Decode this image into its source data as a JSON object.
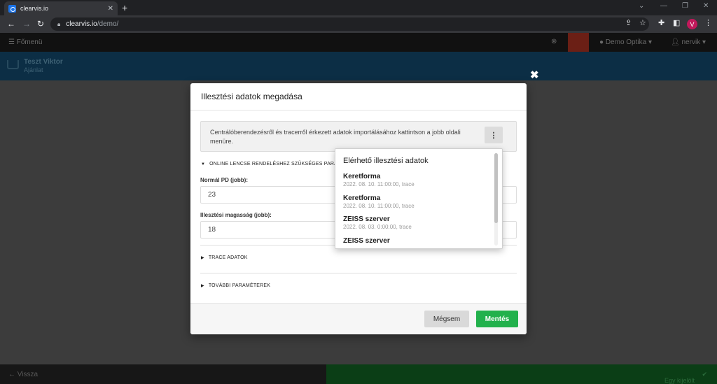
{
  "browser": {
    "tab_title": "clearvis.io",
    "tab_close": "✕",
    "new_tab": "+",
    "url_host": "clearvis.io",
    "url_path": "/demo/",
    "profile_initial": "V"
  },
  "app": {
    "menu_label": "☰ Főmenü",
    "org_label": "Demo Optika",
    "user_label": "nervik",
    "customer_name": "Teszt Viktor",
    "customer_sub": "Ajánlat",
    "back_label": "Vissza",
    "footer_status": "Egy kijelölt ajánlat elfogadásra"
  },
  "modal": {
    "title": "Illesztési adatok megadása",
    "info_text": "Centrálóberendezésről és tracerről érkezett adatok importálásához kattintson a jobb oldali menüre.",
    "kebab_glyph": "⋮",
    "section_online": "ONLINE LENCSE RENDELÉSHEZ SZÜKSÉGES PARAMÉTEREK",
    "pd_label": "Normál PD (jobb):",
    "pd_value": "23",
    "height_label": "Illesztési magasság (jobb):",
    "height_value": "18",
    "section_trace": "TRACE ADATOK",
    "section_more": "TOVÁBBI PARAMÉTEREK",
    "cancel_label": "Mégsem",
    "save_label": "Mentés"
  },
  "dropdown": {
    "title": "Elérhető illesztési adatok",
    "items": [
      {
        "name": "Keretforma",
        "meta": "2022. 08. 10. 11:00:00, trace"
      },
      {
        "name": "Keretforma",
        "meta": "2022. 08. 10. 11:00:00, trace"
      },
      {
        "name": "ZEISS szerver",
        "meta": "2022. 08. 03. 0:00:00, trace"
      },
      {
        "name": "ZEISS szerver",
        "meta": ""
      }
    ]
  }
}
